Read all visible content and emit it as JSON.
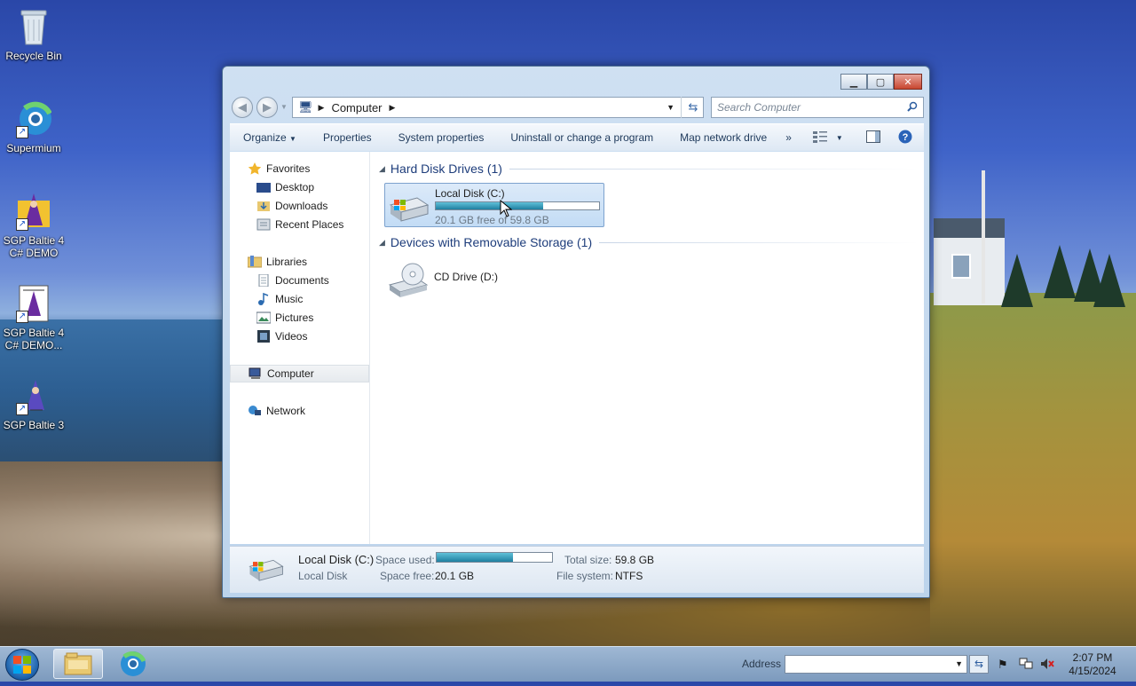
{
  "desktop": {
    "icons": [
      {
        "label": "Recycle Bin"
      },
      {
        "label": "Supermium"
      },
      {
        "label": "SGP Baltie 4 C# DEMO"
      },
      {
        "label": "SGP Baltie 4 C# DEMO..."
      },
      {
        "label": "SGP Baltie 3"
      }
    ]
  },
  "window": {
    "breadcrumb": "Computer",
    "search_placeholder": "Search Computer",
    "toolbar": {
      "organize": "Organize",
      "properties": "Properties",
      "system_properties": "System properties",
      "uninstall": "Uninstall or change a program",
      "map_network_drive": "Map network drive",
      "more": "»"
    },
    "nav": {
      "favorites": "Favorites",
      "desktop": "Desktop",
      "downloads": "Downloads",
      "recent_places": "Recent Places",
      "libraries": "Libraries",
      "documents": "Documents",
      "music": "Music",
      "pictures": "Pictures",
      "videos": "Videos",
      "computer": "Computer",
      "network": "Network"
    },
    "groups": {
      "hdd_title": "Hard Disk Drives (1)",
      "removable_title": "Devices with Removable Storage (1)"
    },
    "drive_c": {
      "name": "Local Disk (C:)",
      "free_text": "20.1 GB free of 59.8 GB",
      "used_fraction": 0.66
    },
    "drive_d": {
      "name": "CD Drive (D:)"
    },
    "details": {
      "name": "Local Disk (C:)",
      "type": "Local Disk",
      "space_used_label": "Space used:",
      "space_free_label": "Space free:",
      "space_free": "20.1 GB",
      "total_size_label": "Total size:",
      "total_size": "59.8 GB",
      "file_system_label": "File system:",
      "file_system": "NTFS",
      "used_fraction": 0.66
    }
  },
  "taskbar": {
    "address_label": "Address",
    "time": "2:07 PM",
    "date": "4/15/2024"
  }
}
